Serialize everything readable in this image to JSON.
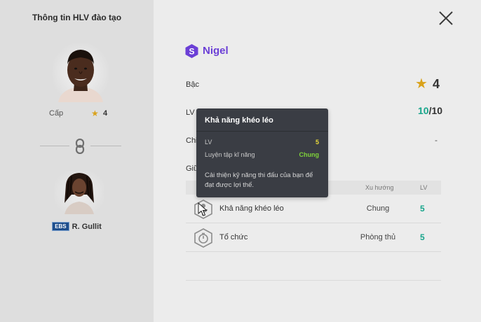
{
  "left": {
    "title": "Thông tin HLV đào tạo",
    "level_label": "Cấp",
    "level_value": "4",
    "legend_badge": "EBS",
    "legend_name": "R. Gullit"
  },
  "coach": {
    "grade_letter": "S",
    "name": "Nigel"
  },
  "stats": {
    "rank_label": "Bậc",
    "rank_value": "4",
    "lv_label": "LV",
    "lv_current": "10",
    "lv_max": "/10",
    "third_label": "Chi",
    "third_value": "-",
    "fourth_label": "Giữ"
  },
  "table": {
    "col_trend": "Xu hướng",
    "col_lv": "LV",
    "rows": [
      {
        "name": "Khả năng khéo léo",
        "trend": "Chung",
        "lv": "5"
      },
      {
        "name": "Tổ chức",
        "trend": "Phòng thủ",
        "lv": "5"
      }
    ]
  },
  "tooltip": {
    "title": "Khả năng khéo léo",
    "lv_label": "LV",
    "lv_value": "5",
    "type_label": "Luyện tập kĩ năng",
    "type_value": "Chung",
    "description": "Cải thiện kỹ năng thi đấu của bạn để đạt được lợi thế."
  },
  "colors": {
    "accent_purple": "#6b3fd6",
    "level_green": "#17a58b",
    "star_gold": "#d9a21b",
    "tooltip_yellow": "#e7d83a",
    "tooltip_green": "#7fd23a"
  },
  "icons": {
    "close": "close-icon",
    "link": "chain-link-icon",
    "skill1": "player-skill-icon",
    "skill2": "organization-hexagon-icon"
  }
}
